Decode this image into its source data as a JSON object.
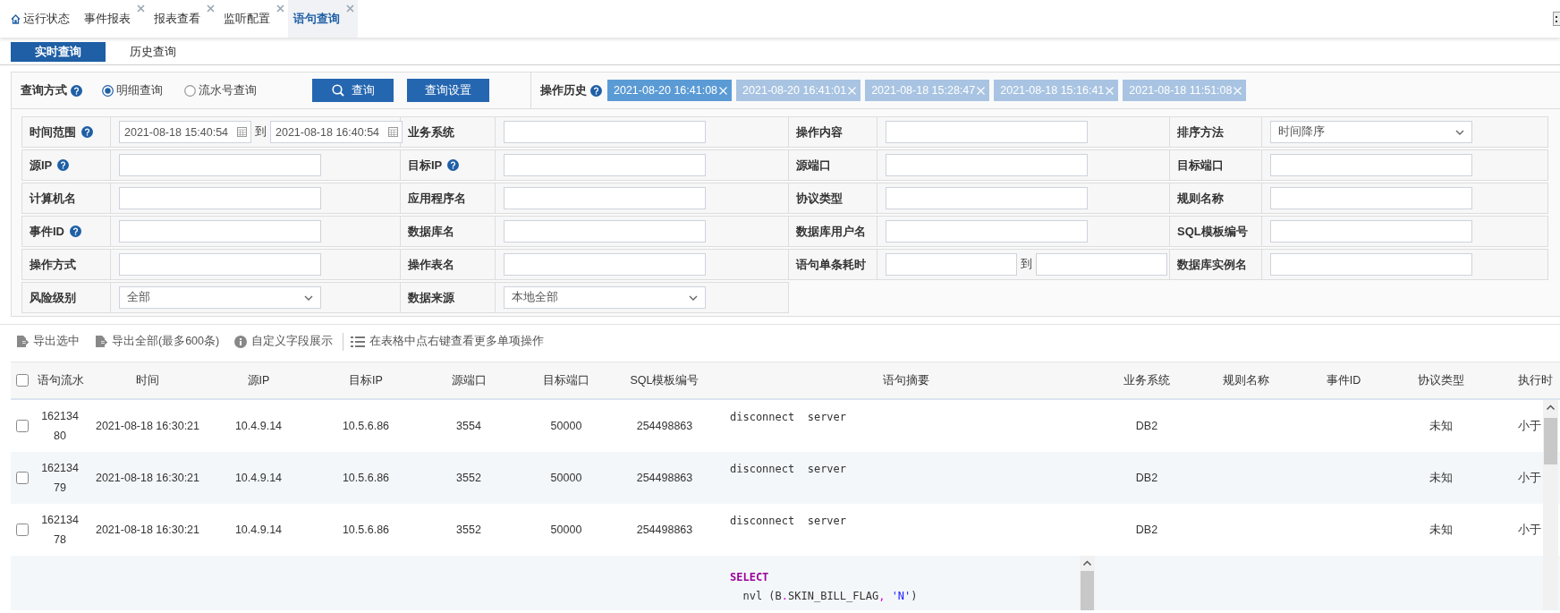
{
  "tabs": [
    {
      "label": "运行状态",
      "kind": "home",
      "closable": false,
      "selected": false
    },
    {
      "label": "事件报表",
      "kind": "page",
      "closable": true,
      "selected": false
    },
    {
      "label": "报表查看",
      "kind": "page",
      "closable": true,
      "selected": false
    },
    {
      "label": "监听配置",
      "kind": "page",
      "closable": true,
      "selected": false
    },
    {
      "label": "语句查询",
      "kind": "page",
      "closable": true,
      "selected": true
    }
  ],
  "sub_tabs": [
    {
      "label": "实时查询",
      "selected": true
    },
    {
      "label": "历史查询",
      "selected": false
    }
  ],
  "query": {
    "mode_label": "查询方式",
    "mode_help": true,
    "modes": [
      {
        "label": "明细查询",
        "selected": true
      },
      {
        "label": "流水号查询",
        "selected": false
      }
    ],
    "buttons": [
      {
        "label": "查询",
        "kind": "search"
      },
      {
        "label": "查询设置",
        "kind": "plain"
      }
    ],
    "history_label": "操作历史",
    "history_help": true,
    "history": [
      {
        "label": "2021-08-20 16:41:08",
        "selected": true
      },
      {
        "label": "2021-08-20 16:41:01",
        "selected": false
      },
      {
        "label": "2021-08-18 15:28:47",
        "selected": false
      },
      {
        "label": "2021-08-18 15:16:41",
        "selected": false
      },
      {
        "label": "2021-08-18 11:51:08",
        "selected": false
      }
    ]
  },
  "form": {
    "rows": [
      [
        {
          "label": "时间范围",
          "help": true,
          "kind": "daterange",
          "from": "2021-08-18 15:40:54",
          "sep": "到",
          "to": "2021-08-18 16:40:54"
        },
        {
          "label": "业务系统",
          "help": false,
          "kind": "text"
        },
        {
          "label": "操作内容",
          "help": false,
          "kind": "text"
        },
        {
          "label": "排序方法",
          "help": false,
          "kind": "select",
          "value": "时间降序"
        }
      ],
      [
        {
          "label": "源IP",
          "help": true,
          "kind": "text"
        },
        {
          "label": "目标IP",
          "help": true,
          "kind": "text"
        },
        {
          "label": "源端口",
          "help": false,
          "kind": "text"
        },
        {
          "label": "目标端口",
          "help": false,
          "kind": "text"
        }
      ],
      [
        {
          "label": "计算机名",
          "help": false,
          "kind": "text"
        },
        {
          "label": "应用程序名",
          "help": false,
          "kind": "text"
        },
        {
          "label": "协议类型",
          "help": false,
          "kind": "text"
        },
        {
          "label": "规则名称",
          "help": false,
          "kind": "text"
        }
      ],
      [
        {
          "label": "事件ID",
          "help": true,
          "kind": "text"
        },
        {
          "label": "数据库名",
          "help": false,
          "kind": "text"
        },
        {
          "label": "数据库用户名",
          "help": false,
          "kind": "text"
        },
        {
          "label": "SQL模板编号",
          "help": false,
          "kind": "text"
        }
      ],
      [
        {
          "label": "操作方式",
          "help": false,
          "kind": "text"
        },
        {
          "label": "操作表名",
          "help": false,
          "kind": "text"
        },
        {
          "label": "语句单条耗时",
          "help": false,
          "kind": "range",
          "sep": "到"
        },
        {
          "label": "数据库实例名",
          "help": false,
          "kind": "text"
        }
      ],
      [
        {
          "label": "风险级别",
          "help": false,
          "kind": "select",
          "value": "全部"
        },
        {
          "label": "数据来源",
          "help": false,
          "kind": "select",
          "value": "本地全部"
        }
      ]
    ]
  },
  "toolbar": [
    {
      "label": "导出选中",
      "kind": "export",
      "separated": false
    },
    {
      "label": "导出全部(最多600条)",
      "kind": "export",
      "separated": false
    },
    {
      "label": "自定义字段展示",
      "kind": "info",
      "separated": false
    },
    {
      "label": "在表格中点右键查看更多单项操作",
      "kind": "list",
      "separated": true
    }
  ],
  "table": {
    "header_checked": false,
    "columns": [
      "语句流水",
      "时间",
      "源IP",
      "目标IP",
      "源端口",
      "目标端口",
      "SQL模板编号",
      "语句摘要",
      "业务系统",
      "规则名称",
      "事件ID",
      "协议类型",
      "执行时"
    ],
    "rows": [
      {
        "checked": false,
        "serial": "16213480",
        "time": "2021-08-18 16:30:21",
        "src_ip": "10.4.9.14",
        "dst_ip": "10.5.6.86",
        "src_port": "3554",
        "dst_port": "50000",
        "sql_template": "254498863",
        "summary": "disconnect  server",
        "business_system": "DB2",
        "protocol": "未知",
        "duration": "小于"
      },
      {
        "checked": false,
        "serial": "16213479",
        "time": "2021-08-18 16:30:21",
        "src_ip": "10.4.9.14",
        "dst_ip": "10.5.6.86",
        "src_port": "3552",
        "dst_port": "50000",
        "sql_template": "254498863",
        "summary": "disconnect  server",
        "business_system": "DB2",
        "protocol": "未知",
        "duration": "小于"
      },
      {
        "checked": false,
        "serial": "16213478",
        "time": "2021-08-18 16:30:21",
        "src_ip": "10.4.9.14",
        "dst_ip": "10.5.6.86",
        "src_port": "3552",
        "dst_port": "50000",
        "sql_template": "254498863",
        "summary": "disconnect  server",
        "business_system": "DB2",
        "protocol": "未知",
        "duration": "小于"
      },
      {
        "code": [
          [
            {
              "kind": "keyword",
              "text": "SELECT"
            }
          ],
          [
            {
              "kind": "plain",
              "text": "  nvl (B"
            },
            {
              "kind": "punct",
              "text": "."
            },
            {
              "kind": "plain",
              "text": "SKIN_BILL_FLAG"
            },
            {
              "kind": "punct",
              "text": ","
            },
            {
              "kind": "string",
              "text": " 'N'"
            },
            {
              "kind": "plain",
              "text": ")"
            }
          ]
        ]
      }
    ]
  }
}
